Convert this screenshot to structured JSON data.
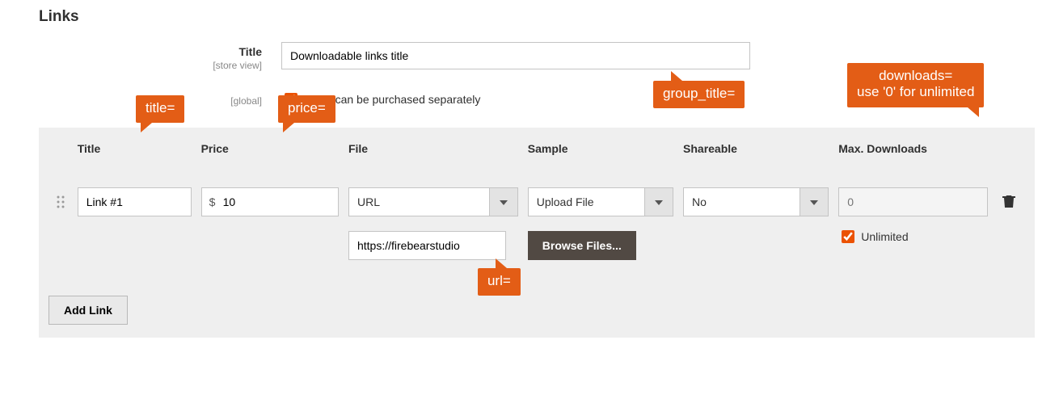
{
  "section_title": "Links",
  "title_field": {
    "label": "Title",
    "scope": "[store view]",
    "value": "Downloadable links title"
  },
  "separately": {
    "scope": "[global]",
    "label": "Links can be purchased separately",
    "checked": true
  },
  "grid": {
    "headers": {
      "title": "Title",
      "price": "Price",
      "file": "File",
      "sample": "Sample",
      "shareable": "Shareable",
      "max": "Max. Downloads"
    },
    "rows": [
      {
        "title": "Link #1",
        "price_prefix": "$",
        "price": "10",
        "file_type": "URL",
        "file_url": "https://firebearstudio",
        "sample_type": "Upload File",
        "browse_label": "Browse Files...",
        "shareable": "No",
        "max_placeholder": "0",
        "unlimited_label": "Unlimited",
        "unlimited_checked": true
      }
    ],
    "add_link": "Add Link"
  },
  "callouts": {
    "group_title": "group_title=",
    "title": "title=",
    "price": "price=",
    "url": "url=",
    "downloads": "downloads=\nuse '0' for unlimited"
  }
}
